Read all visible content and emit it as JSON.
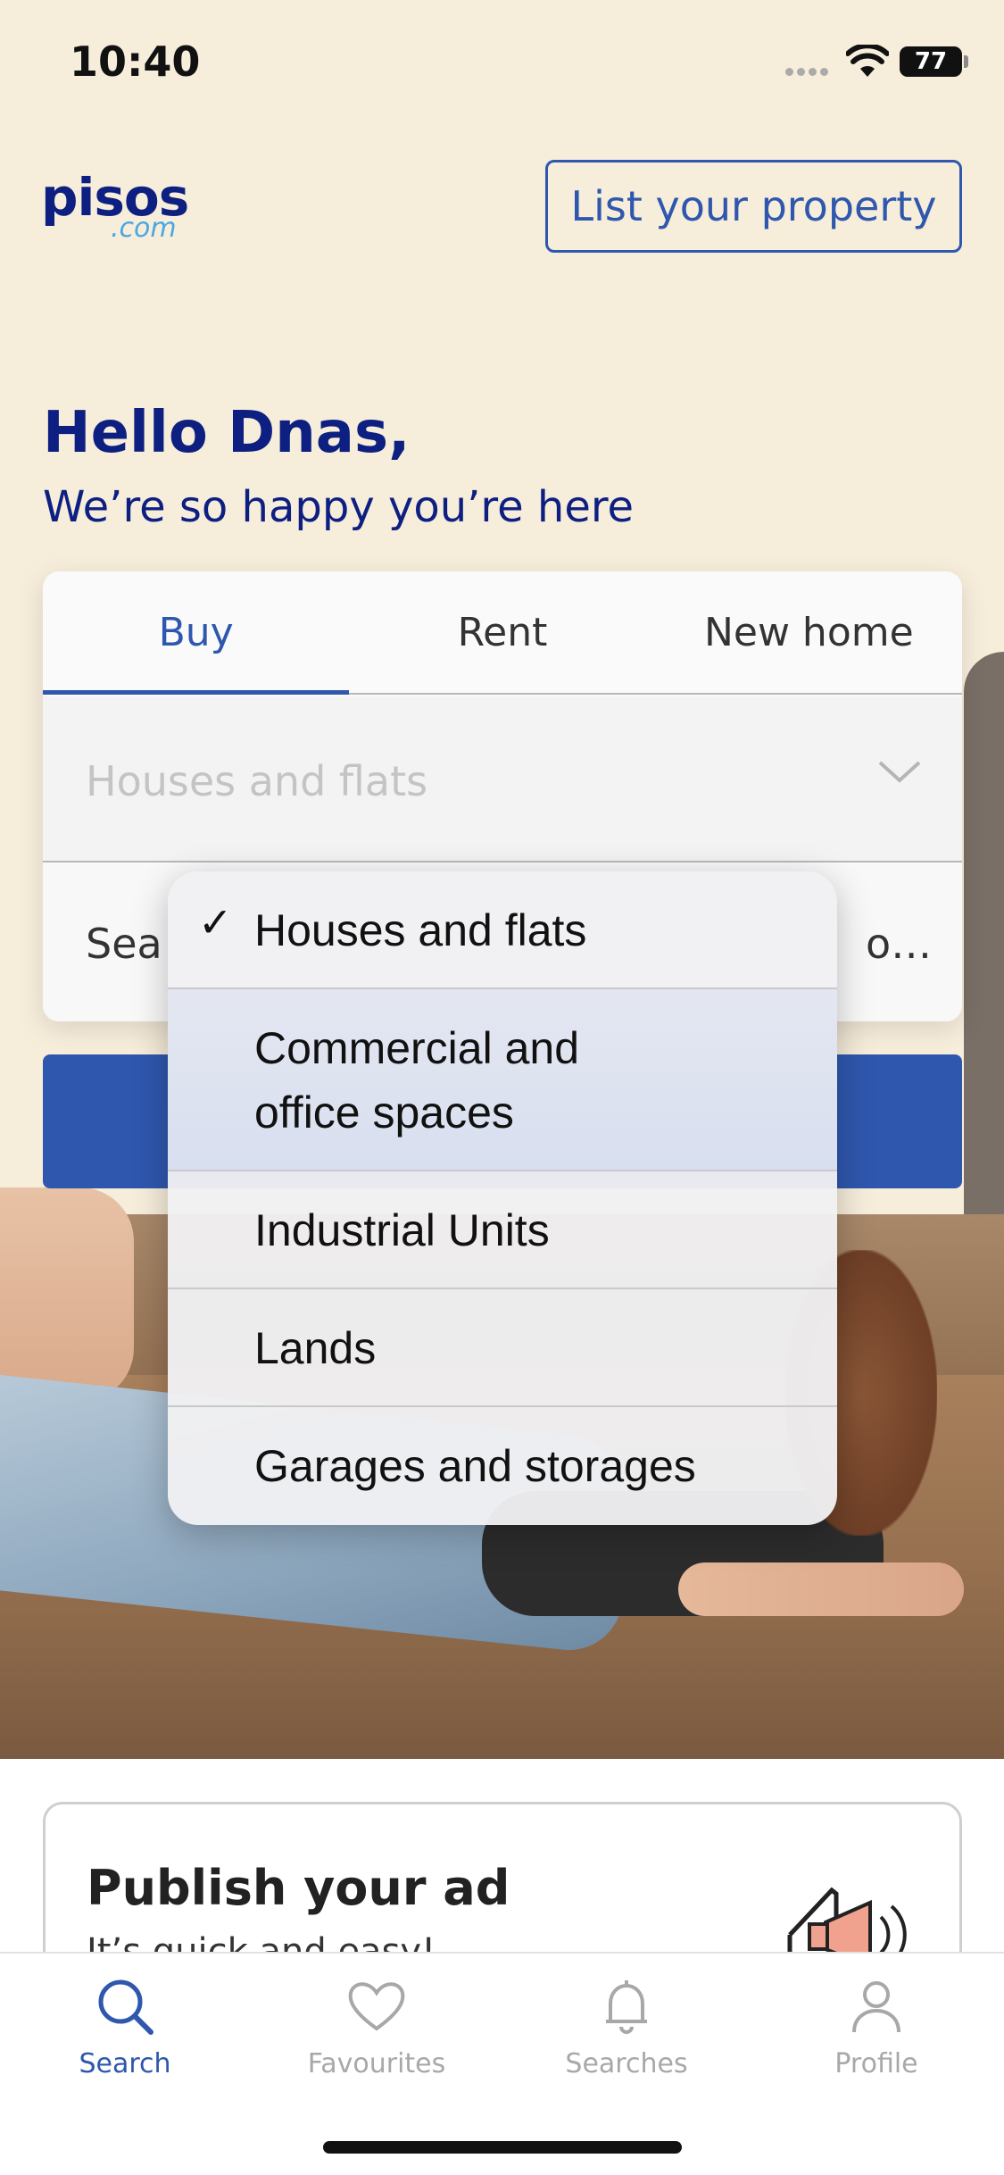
{
  "status_bar": {
    "time": "10:40",
    "battery": "77"
  },
  "header": {
    "logo_main": "pisos",
    "logo_sub": ".com",
    "list_property_label": "List your property"
  },
  "greeting": {
    "title": "Hello Dnas,",
    "subtitle": "We’re so happy you’re here"
  },
  "search": {
    "tabs": [
      {
        "label": "Buy",
        "active": true
      },
      {
        "label": "Rent",
        "active": false
      },
      {
        "label": "New home",
        "active": false
      }
    ],
    "property_type_value": "Houses and flats",
    "location_placeholder_start": "Sea",
    "location_placeholder_end": "o…"
  },
  "dropdown": {
    "items": [
      {
        "label": "Houses and flats",
        "selected": true,
        "check": "✓"
      },
      {
        "label_line1": "Commercial and",
        "label_line2": "office spaces",
        "selected": false
      },
      {
        "label": "Industrial Units",
        "selected": false
      },
      {
        "label": "Lands",
        "selected": false
      },
      {
        "label": "Garages and storages",
        "selected": false
      }
    ]
  },
  "publish": {
    "title": "Publish your ad",
    "subtitle": "It’s quick and easy!"
  },
  "bottom_nav": {
    "items": [
      {
        "label": "Search",
        "icon": "search-icon",
        "active": true
      },
      {
        "label": "Favourites",
        "icon": "heart-icon",
        "active": false
      },
      {
        "label": "Searches",
        "icon": "bell-icon",
        "active": false
      },
      {
        "label": "Profile",
        "icon": "user-icon",
        "active": false
      }
    ]
  },
  "colors": {
    "brand_blue": "#2f57ad",
    "dark_blue": "#0e1f82",
    "background": "#f7eddb"
  }
}
